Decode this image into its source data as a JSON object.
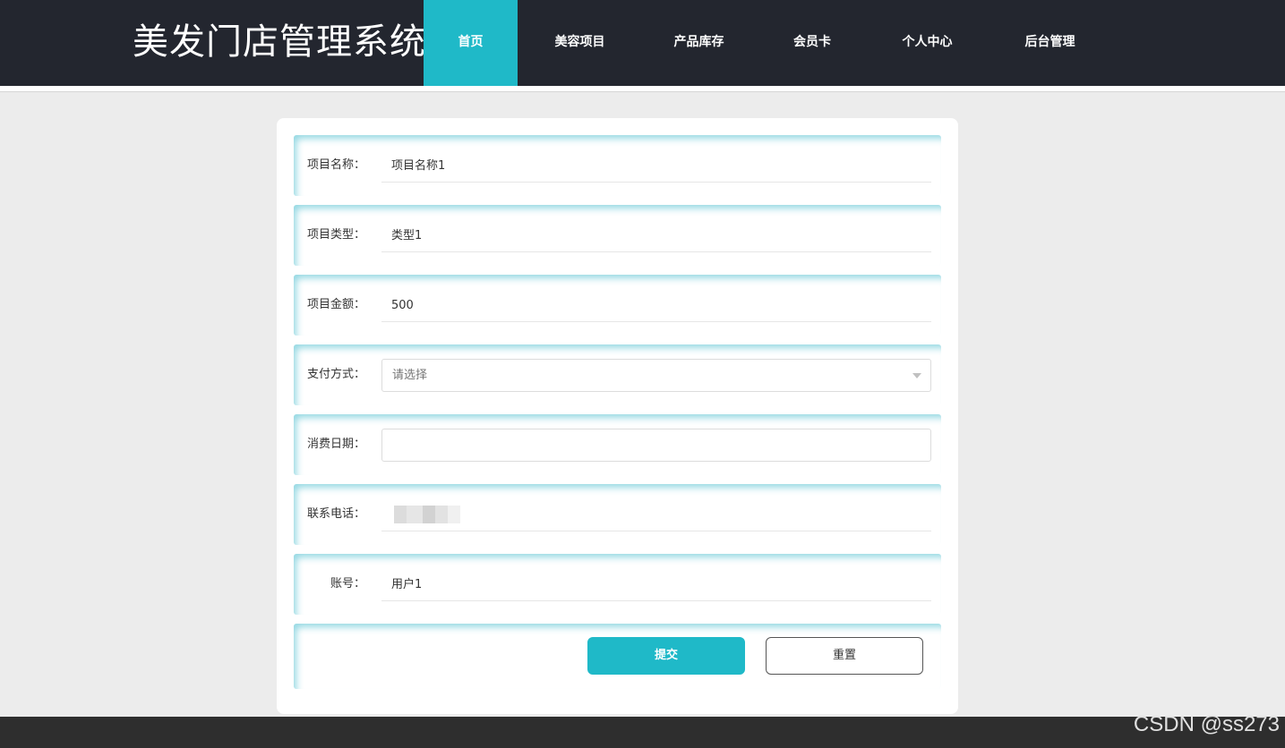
{
  "header": {
    "title": "美发门店管理系统",
    "nav": [
      {
        "label": "首页",
        "active": true
      },
      {
        "label": "美容项目",
        "active": false
      },
      {
        "label": "产品库存",
        "active": false
      },
      {
        "label": "会员卡",
        "active": false
      },
      {
        "label": "个人中心",
        "active": false
      },
      {
        "label": "后台管理",
        "active": false
      }
    ]
  },
  "form": {
    "fields": [
      {
        "label": "项目名称：",
        "value": "项目名称1"
      },
      {
        "label": "项目类型：",
        "value": "类型1"
      },
      {
        "label": "项目金额：",
        "value": "500"
      },
      {
        "label": "支付方式：",
        "placeholder": "请选择"
      },
      {
        "label": "消费日期：",
        "value": ""
      },
      {
        "label": "联系电话：",
        "value": ""
      },
      {
        "label": "账号：",
        "value": "用户1"
      }
    ],
    "submit_label": "提交",
    "reset_label": "重置"
  },
  "watermark": "CSDN @ss273",
  "colors": {
    "header_bg": "#23262f",
    "accent": "#1fb9c8",
    "page_bg": "#ececec",
    "footer_bg": "#2e2e2e"
  }
}
